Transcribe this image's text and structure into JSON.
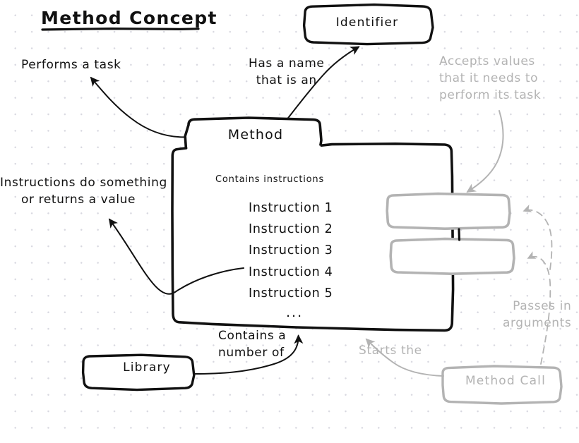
{
  "title": {
    "text": "Method Concept"
  },
  "nodes": {
    "identifier": {
      "label": "Identifier"
    },
    "method": {
      "label": "Method"
    },
    "library": {
      "label": "Library"
    },
    "method_call": {
      "label": "Method Call"
    },
    "parameter_box_1": {
      "label": ""
    },
    "parameter_box_2": {
      "label": ""
    }
  },
  "method_body": {
    "caption": "Contains instructions",
    "instructions": [
      "Instruction 1",
      "Instruction 2",
      "Instruction 3",
      "Instruction 4",
      "Instruction 5"
    ],
    "ellipsis": "..."
  },
  "annotations": {
    "performs_a_task": "Performs a task",
    "has_a_name": "Has a name\nthat is an",
    "instructions_do": "Instructions do something\n     or returns a value",
    "accepts_values": "Accepts values\nthat it needs to\nperform its task",
    "passes_in_arguments": "Passes in\narguments",
    "starts_the": "Starts the",
    "contains_a_number_of": "Contains a\nnumber of"
  },
  "colors": {
    "ink": "#111111",
    "gray_ink": "#b3b3b3",
    "paper": "#ffffff",
    "grid_dot": "#d8d8e0"
  }
}
